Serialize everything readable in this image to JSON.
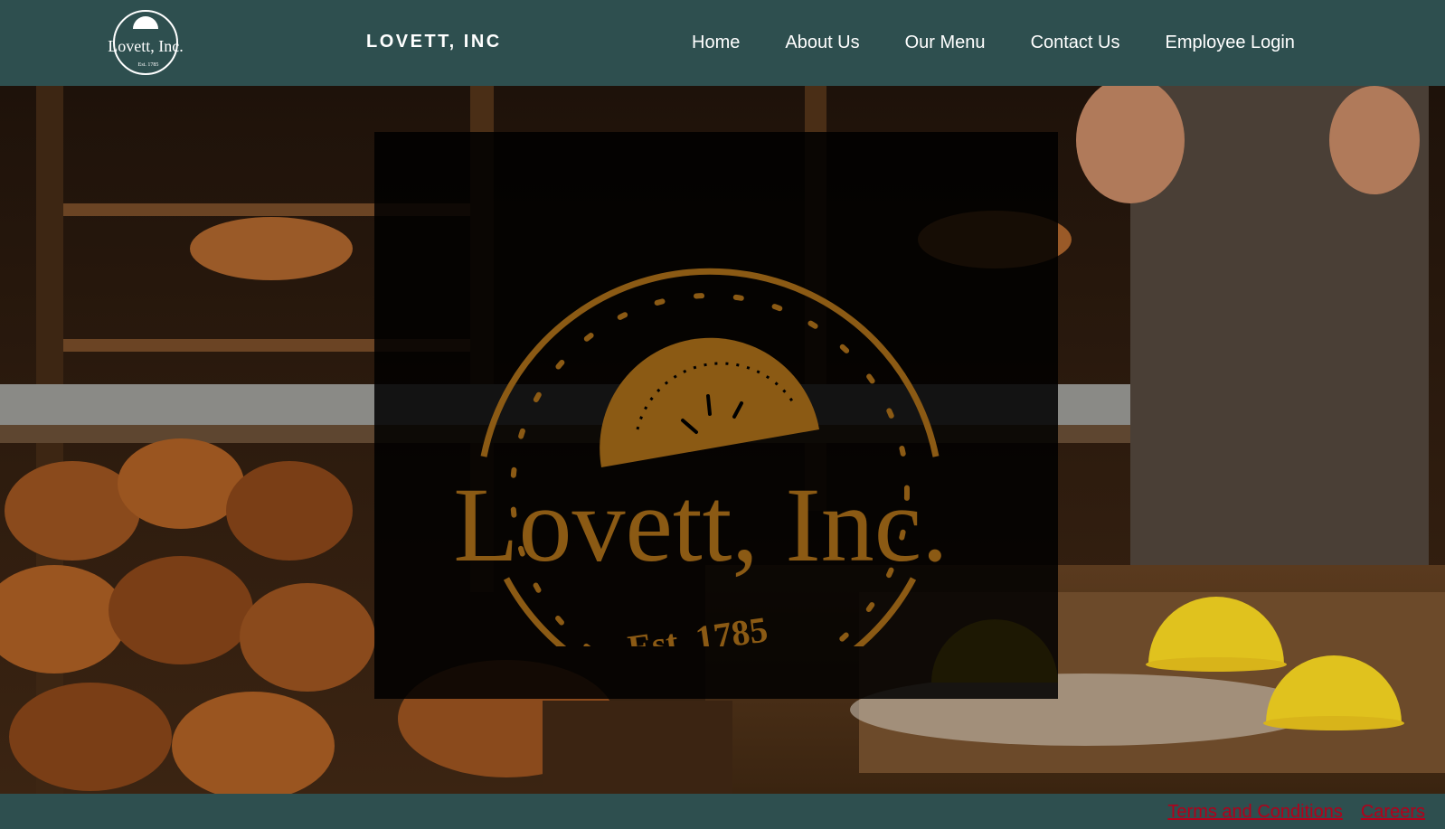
{
  "header": {
    "brand": "LOVETT, INC",
    "logo_text": "Lovett, Inc.",
    "logo_est": "Est. 1785",
    "nav": [
      {
        "label": "Home"
      },
      {
        "label": "About Us"
      },
      {
        "label": "Our Menu"
      },
      {
        "label": "Contact Us"
      },
      {
        "label": "Employee Login"
      }
    ]
  },
  "hero": {
    "logo_text": "Lovett, Inc.",
    "logo_est": "Est. 1785",
    "image_description_icon": "bakery-photo"
  },
  "footer": {
    "links": [
      {
        "label": "Terms and Conditions"
      },
      {
        "label": "Careers"
      }
    ]
  },
  "colors": {
    "bar": "#2e4f4f",
    "logo_gold": "#8b5a14",
    "footer_link": "#b3001b"
  }
}
